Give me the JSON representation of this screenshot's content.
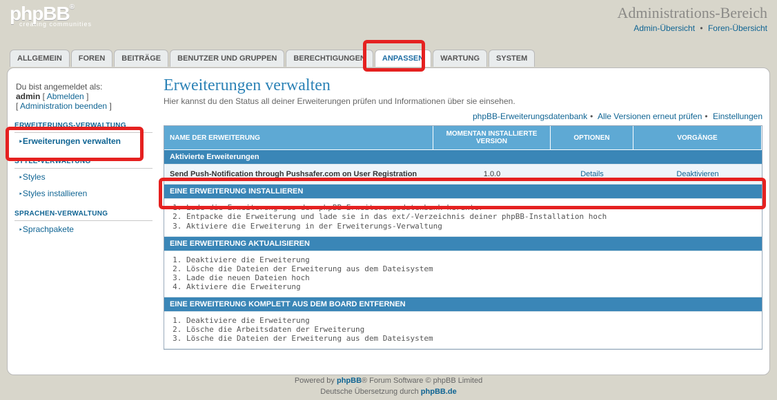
{
  "header": {
    "logo_main": "phpBB",
    "logo_reg": "®",
    "logo_sub": "creating communities",
    "title": "Administrations-Bereich",
    "link_admin": "Admin-Übersicht",
    "link_forum": "Foren-Übersicht"
  },
  "tabs": [
    "ALLGEMEIN",
    "FOREN",
    "BEITRÄGE",
    "BENUTZER UND GRUPPEN",
    "BERECHTIGUNGEN",
    "ANPASSEN",
    "WARTUNG",
    "SYSTEM"
  ],
  "active_tab": 5,
  "sidebar": {
    "logged_in_as": "Du bist angemeldet als:",
    "user": "admin",
    "logout": "Abmelden",
    "end_admin": "Administration beenden",
    "groups": [
      {
        "title": "ERWEITERUNGS-VERWALTUNG",
        "items": [
          "Erweiterungen verwalten"
        ],
        "active": 0
      },
      {
        "title": "STYLE-VERWALTUNG",
        "items": [
          "Styles",
          "Styles installieren"
        ]
      },
      {
        "title": "SPRACHEN-VERWALTUNG",
        "items": [
          "Sprachpakete"
        ]
      }
    ]
  },
  "content": {
    "h1": "Erweiterungen verwalten",
    "sub": "Hier kannst du den Status all deiner Erweiterungen prüfen und Informationen über sie einsehen.",
    "top_links": [
      "phpBB-Erweiterungsdatenbank",
      "Alle Versionen erneut prüfen",
      "Einstellungen"
    ],
    "thead": [
      "NAME DER ERWEITERUNG",
      "MOMENTAN INSTALLIERTE VERSION",
      "OPTIONEN",
      "VORGÄNGE"
    ],
    "section_active": "Aktivierte Erweiterungen",
    "row": {
      "name": "Send Push-Notification through Pushsafer.com on User Registration",
      "version": "1.0.0",
      "details": "Details",
      "action": "Deaktivieren"
    },
    "section_install": "EINE ERWEITERUNG INSTALLIEREN",
    "steps_install": [
      "Lade die Erweiterung aus der phpBB-Erweiterungsdatenbank herunter",
      "Entpacke die Erweiterung und lade sie in das ext/-Verzeichnis deiner phpBB-Installation hoch",
      "Aktiviere die Erweiterung in der Erweiterungs-Verwaltung"
    ],
    "section_update": "EINE ERWEITERUNG AKTUALISIEREN",
    "steps_update": [
      "Deaktiviere die Erweiterung",
      "Lösche die Dateien der Erweiterung aus dem Dateisystem",
      "Lade die neuen Dateien hoch",
      "Aktiviere die Erweiterung"
    ],
    "section_remove": "EINE ERWEITERUNG KOMPLETT AUS DEM BOARD ENTFERNEN",
    "steps_remove": [
      "Deaktiviere die Erweiterung",
      "Lösche die Arbeitsdaten der Erweiterung",
      "Lösche die Dateien der Erweiterung aus dem Dateisystem"
    ]
  },
  "footer": {
    "l1a": "Powered by ",
    "l1b": "phpBB",
    "l1c": "® Forum Software © phpBB Limited",
    "l2a": "Deutsche Übersetzung durch ",
    "l2b": "phpBB.de"
  }
}
